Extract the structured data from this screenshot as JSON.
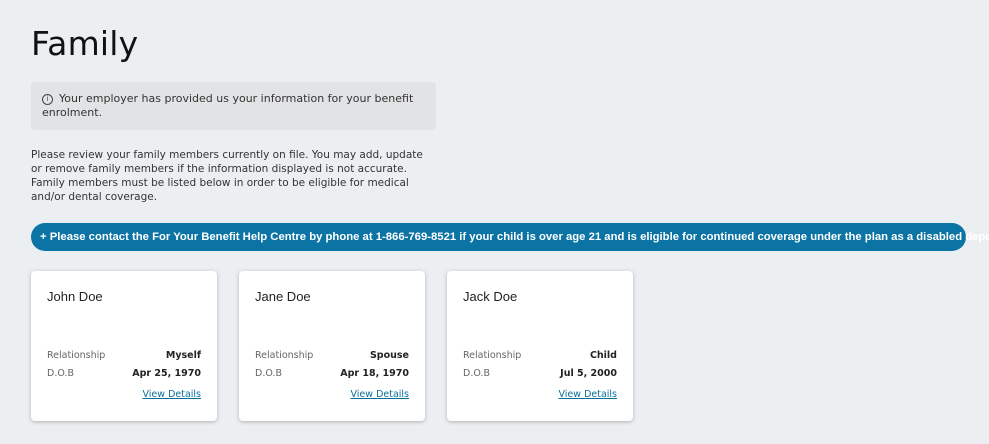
{
  "page": {
    "title": "Family"
  },
  "info_box": {
    "icon": "info-icon",
    "text": "Your employer has provided us your information for your benefit enrolment."
  },
  "review_text": "Please review your family members currently on file. You may add, update or remove family members if the information displayed is not accurate. Family members must be listed below in order to be eligible for medical and/or dental coverage.",
  "banner": {
    "text": "+ Please contact the For Your Benefit Help Centre by phone at 1-866-769-8521 if your child is over age 21 and is eligible for continued coverage under the plan as a disabled dependent.",
    "color": "#0b74a4"
  },
  "members": [
    {
      "name": "John Doe",
      "relationship_label": "Relationship",
      "relationship": "Myself",
      "dob_label": "D.O.B",
      "dob": "Apr 25, 1970",
      "link_label": "View Details"
    },
    {
      "name": "Jane Doe",
      "relationship_label": "Relationship",
      "relationship": "Spouse",
      "dob_label": "D.O.B",
      "dob": "Apr 18, 1970",
      "link_label": "View Details"
    },
    {
      "name": "Jack Doe",
      "relationship_label": "Relationship",
      "relationship": "Child",
      "dob_label": "D.O.B",
      "dob": "Jul 5, 2000",
      "link_label": "View Details"
    }
  ]
}
